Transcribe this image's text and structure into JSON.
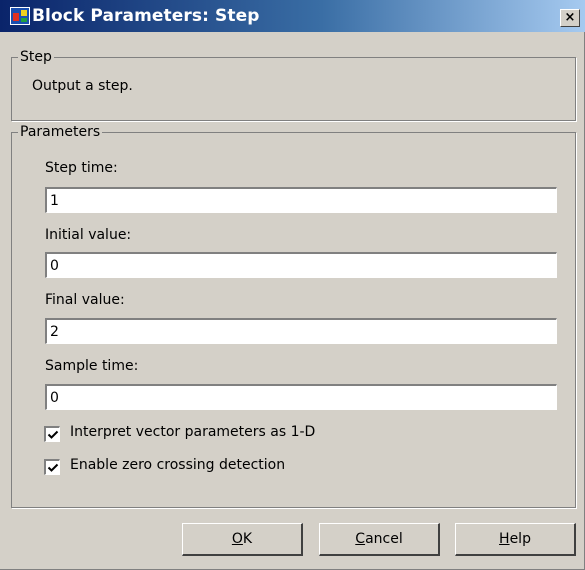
{
  "window": {
    "title": "Block Parameters: Step",
    "close_label": "×"
  },
  "step_group": {
    "legend": "Step",
    "description": "Output a step."
  },
  "parameters": {
    "legend": "Parameters",
    "fields": [
      {
        "label": "Step time:",
        "value": "1"
      },
      {
        "label": "Initial value:",
        "value": "0"
      },
      {
        "label": "Final value:",
        "value": "2"
      },
      {
        "label": "Sample time:",
        "value": "0"
      }
    ],
    "checkboxes": [
      {
        "label": "Interpret vector parameters as 1-D",
        "checked": true
      },
      {
        "label": "Enable zero crossing detection",
        "checked": true
      }
    ]
  },
  "buttons": {
    "ok": {
      "accel": "O",
      "rest": "K"
    },
    "cancel": {
      "accel": "C",
      "rest": "ancel"
    },
    "help": {
      "accel": "H",
      "rest": "elp"
    }
  },
  "icons": [
    "simulink-block-icon",
    "close-icon",
    "checkmark-icon"
  ]
}
